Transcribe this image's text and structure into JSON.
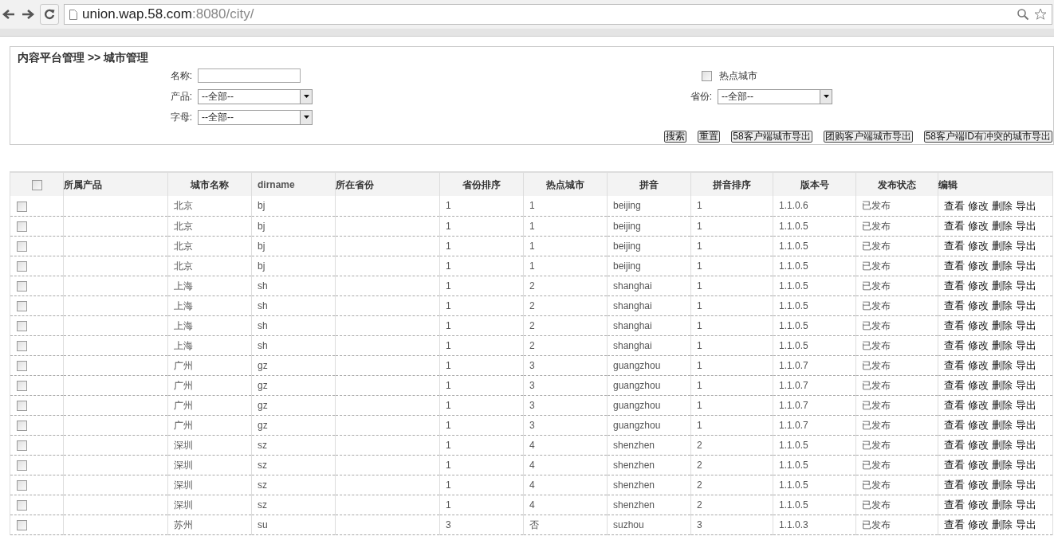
{
  "browser": {
    "url_host": "union.wap.58.com",
    "url_rest": ":8080/city/"
  },
  "breadcrumb": "内容平台管理 >> 城市管理",
  "filters": [
    {
      "kind": "text",
      "label": "名称:"
    },
    {
      "kind": "checkbox",
      "label": "热点城市",
      "checked": false
    },
    {
      "kind": "select",
      "label": "产品:",
      "value": "--全部--"
    },
    {
      "kind": "select",
      "label": "省份:",
      "value": "--全部--"
    },
    {
      "kind": "select",
      "label": "字母:",
      "value": "--全部--"
    }
  ],
  "buttons": [
    "搜索",
    "重置",
    "58客户端城市导出",
    "团购客户端城市导出",
    "58客户端ID有冲突的城市导出"
  ],
  "table": {
    "select_all_checked": false,
    "columns": [
      "所属产品",
      "城市名称",
      "dirname",
      "所在省份",
      "省份排序",
      "热点城市",
      "拼音",
      "拼音排序",
      "版本号",
      "发布状态",
      "编辑"
    ],
    "rows": [
      {
        "checked": false,
        "cells": [
          "",
          "北京",
          "bj",
          "",
          "1",
          "1",
          "beijing",
          "1",
          "1.1.0.6",
          "已发布"
        ],
        "actions": [
          "查看",
          "修改",
          "删除",
          "导出"
        ]
      },
      {
        "checked": false,
        "cells": [
          "",
          "北京",
          "bj",
          "",
          "1",
          "1",
          "beijing",
          "1",
          "1.1.0.5",
          "已发布"
        ],
        "actions": [
          "查看",
          "修改",
          "删除",
          "导出"
        ]
      },
      {
        "checked": false,
        "cells": [
          "",
          "北京",
          "bj",
          "",
          "1",
          "1",
          "beijing",
          "1",
          "1.1.0.5",
          "已发布"
        ],
        "actions": [
          "查看",
          "修改",
          "删除",
          "导出"
        ]
      },
      {
        "checked": false,
        "cells": [
          "",
          "北京",
          "bj",
          "",
          "1",
          "1",
          "beijing",
          "1",
          "1.1.0.5",
          "已发布"
        ],
        "actions": [
          "查看",
          "修改",
          "删除",
          "导出"
        ]
      },
      {
        "checked": false,
        "cells": [
          "",
          "上海",
          "sh",
          "",
          "1",
          "2",
          "shanghai",
          "1",
          "1.1.0.5",
          "已发布"
        ],
        "actions": [
          "查看",
          "修改",
          "删除",
          "导出"
        ]
      },
      {
        "checked": false,
        "cells": [
          "",
          "上海",
          "sh",
          "",
          "1",
          "2",
          "shanghai",
          "1",
          "1.1.0.5",
          "已发布"
        ],
        "actions": [
          "查看",
          "修改",
          "删除",
          "导出"
        ]
      },
      {
        "checked": false,
        "cells": [
          "",
          "上海",
          "sh",
          "",
          "1",
          "2",
          "shanghai",
          "1",
          "1.1.0.5",
          "已发布"
        ],
        "actions": [
          "查看",
          "修改",
          "删除",
          "导出"
        ]
      },
      {
        "checked": false,
        "cells": [
          "",
          "上海",
          "sh",
          "",
          "1",
          "2",
          "shanghai",
          "1",
          "1.1.0.5",
          "已发布"
        ],
        "actions": [
          "查看",
          "修改",
          "删除",
          "导出"
        ]
      },
      {
        "checked": false,
        "cells": [
          "",
          "广州",
          "gz",
          "",
          "1",
          "3",
          "guangzhou",
          "1",
          "1.1.0.7",
          "已发布"
        ],
        "actions": [
          "查看",
          "修改",
          "删除",
          "导出"
        ]
      },
      {
        "checked": false,
        "cells": [
          "",
          "广州",
          "gz",
          "",
          "1",
          "3",
          "guangzhou",
          "1",
          "1.1.0.7",
          "已发布"
        ],
        "actions": [
          "查看",
          "修改",
          "删除",
          "导出"
        ]
      },
      {
        "checked": false,
        "cells": [
          "",
          "广州",
          "gz",
          "",
          "1",
          "3",
          "guangzhou",
          "1",
          "1.1.0.7",
          "已发布"
        ],
        "actions": [
          "查看",
          "修改",
          "删除",
          "导出"
        ]
      },
      {
        "checked": false,
        "cells": [
          "",
          "广州",
          "gz",
          "",
          "1",
          "3",
          "guangzhou",
          "1",
          "1.1.0.7",
          "已发布"
        ],
        "actions": [
          "查看",
          "修改",
          "删除",
          "导出"
        ]
      },
      {
        "checked": false,
        "cells": [
          "",
          "深圳",
          "sz",
          "",
          "1",
          "4",
          "shenzhen",
          "2",
          "1.1.0.5",
          "已发布"
        ],
        "actions": [
          "查看",
          "修改",
          "删除",
          "导出"
        ]
      },
      {
        "checked": false,
        "cells": [
          "",
          "深圳",
          "sz",
          "",
          "1",
          "4",
          "shenzhen",
          "2",
          "1.1.0.5",
          "已发布"
        ],
        "actions": [
          "查看",
          "修改",
          "删除",
          "导出"
        ]
      },
      {
        "checked": false,
        "cells": [
          "",
          "深圳",
          "sz",
          "",
          "1",
          "4",
          "shenzhen",
          "2",
          "1.1.0.5",
          "已发布"
        ],
        "actions": [
          "查看",
          "修改",
          "删除",
          "导出"
        ]
      },
      {
        "checked": false,
        "cells": [
          "",
          "深圳",
          "sz",
          "",
          "1",
          "4",
          "shenzhen",
          "2",
          "1.1.0.5",
          "已发布"
        ],
        "actions": [
          "查看",
          "修改",
          "删除",
          "导出"
        ]
      },
      {
        "checked": false,
        "cells": [
          "",
          "苏州",
          "su",
          "",
          "3",
          "否",
          "suzhou",
          "3",
          "1.1.0.3",
          "已发布"
        ],
        "actions": [
          "查看",
          "修改",
          "删除",
          "导出"
        ]
      }
    ]
  }
}
